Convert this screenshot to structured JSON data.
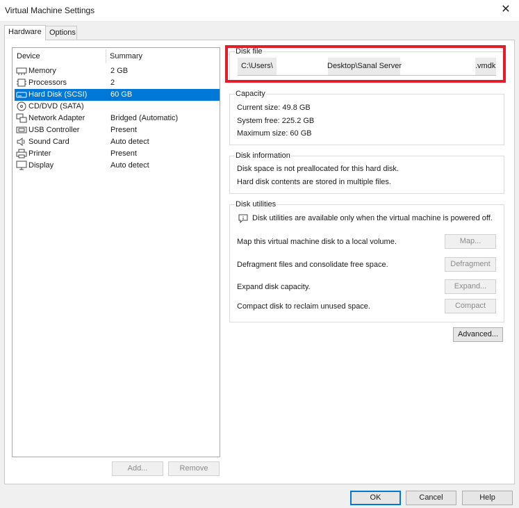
{
  "window": {
    "title": "Virtual Machine Settings",
    "close_glyph": "✕"
  },
  "tabs": [
    {
      "label": "Hardware",
      "active": true
    },
    {
      "label": "Options",
      "active": false
    }
  ],
  "device_list": {
    "header_device": "Device",
    "header_summary": "Summary",
    "items": [
      {
        "name": "Memory",
        "summary": "2 GB",
        "icon": "memory-icon"
      },
      {
        "name": "Processors",
        "summary": "2",
        "icon": "processor-icon"
      },
      {
        "name": "Hard Disk (SCSI)",
        "summary": "60 GB",
        "icon": "hard-disk-icon",
        "selected": true
      },
      {
        "name": "CD/DVD (SATA)",
        "summary": "",
        "icon": "cd-dvd-icon"
      },
      {
        "name": "Network Adapter",
        "summary": "Bridged (Automatic)",
        "icon": "network-adapter-icon"
      },
      {
        "name": "USB Controller",
        "summary": "Present",
        "icon": "usb-controller-icon"
      },
      {
        "name": "Sound Card",
        "summary": "Auto detect",
        "icon": "sound-card-icon"
      },
      {
        "name": "Printer",
        "summary": "Present",
        "icon": "printer-icon"
      },
      {
        "name": "Display",
        "summary": "Auto detect",
        "icon": "display-icon"
      }
    ],
    "add_label": "Add...",
    "remove_label": "Remove"
  },
  "disk_file": {
    "label": "Disk file",
    "path_part1": "C:\\Users\\",
    "path_part2": "Desktop\\Sanal Server",
    "path_part3": ".vmdk"
  },
  "capacity": {
    "label": "Capacity",
    "current_size": "Current size:  49.8 GB",
    "system_free": "System free:  225.2 GB",
    "maximum_size": "Maximum size:  60 GB"
  },
  "disk_information": {
    "label": "Disk information",
    "line1": "Disk space is not preallocated for this hard disk.",
    "line2": "Hard disk contents are stored in multiple files."
  },
  "disk_utilities": {
    "label": "Disk utilities",
    "notice": "Disk utilities are available only when the virtual machine is powered off.",
    "map_text": "Map this virtual machine disk to a local volume.",
    "map_button": "Map...",
    "defrag_text": "Defragment files and consolidate free space.",
    "defrag_button": "Defragment",
    "expand_text": "Expand disk capacity.",
    "expand_button": "Expand...",
    "compact_text": "Compact disk to reclaim unused space.",
    "compact_button": "Compact"
  },
  "advanced_button": "Advanced...",
  "footer": {
    "ok": "OK",
    "cancel": "Cancel",
    "help": "Help"
  },
  "colors": {
    "selection": "#0078d7",
    "highlight_border": "#e31d2a"
  }
}
